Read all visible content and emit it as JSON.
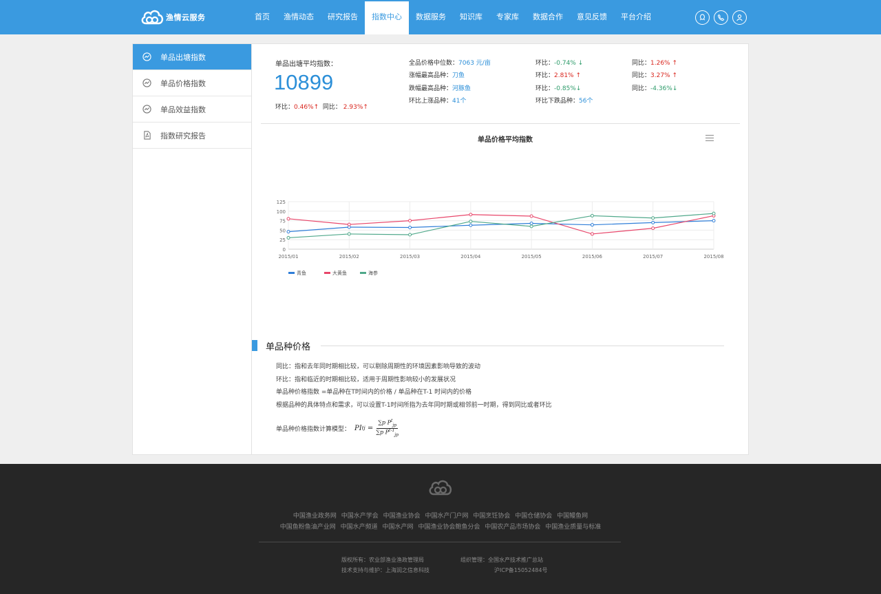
{
  "header": {
    "logo_text": "渔情云服务",
    "nav": [
      "首页",
      "渔情动态",
      "研究报告",
      "指数中心",
      "数据服务",
      "知识库",
      "专家库",
      "数据合作",
      "意见反馈",
      "平台介绍"
    ],
    "active_nav": "指数中心",
    "icons": [
      "qq-icon",
      "phone-icon",
      "user-icon"
    ]
  },
  "sidebar": {
    "items": [
      {
        "label": "单品出塘指数",
        "icon": "trend-icon",
        "active": true
      },
      {
        "label": "单品价格指数",
        "icon": "trend-icon",
        "active": false
      },
      {
        "label": "单品效益指数",
        "icon": "trend-icon",
        "active": false
      },
      {
        "label": "指数研究报告",
        "icon": "pdf-icon",
        "active": false
      }
    ]
  },
  "stats": {
    "avg_label": "单品出塘平均指数：",
    "avg_value": "10899",
    "huanbi_label": "环比：",
    "huanbi_value": "0.46%",
    "tongbi_label": "同比：",
    "tongbi_value": "2.93%",
    "rows": [
      {
        "label": "全品价格中位数：",
        "value": "7063 元/亩",
        "hb_label": "环比：",
        "hb": "-0.74%",
        "hb_dir": "down",
        "tb_label": "同比：",
        "tb": "1.26%",
        "tb_dir": "up"
      },
      {
        "label": "涨幅最高品种：",
        "value": "刀鱼",
        "hb_label": "环比：",
        "hb": "2.81%",
        "hb_dir": "up",
        "tb_label": "同比：",
        "tb": "3.27%",
        "tb_dir": "up"
      },
      {
        "label": "跌幅最高品种：",
        "value": "河豚鱼",
        "hb_label": "环比：",
        "hb": "-0.85%",
        "hb_dir": "down",
        "tb_label": "同比：",
        "tb": "-4.36%",
        "tb_dir": "down"
      }
    ],
    "up_label": "环比上涨品种：",
    "up_value": "41个",
    "down_label": "环比下跌品种：",
    "down_value": "56个"
  },
  "chart_data": {
    "type": "line",
    "title": "单品价格平均指数",
    "x": [
      "2015/01",
      "2015/02",
      "2015/03",
      "2015/04",
      "2015/05",
      "2015/06",
      "2015/07",
      "2015/08"
    ],
    "ylim": [
      0,
      125
    ],
    "yticks": [
      0,
      25,
      50,
      75,
      100,
      125
    ],
    "grid": true,
    "legend": "bottom-left",
    "series": [
      {
        "name": "青鱼",
        "color": "#2f7ed8",
        "values": [
          46,
          58,
          57,
          63,
          68,
          64,
          70,
          75
        ]
      },
      {
        "name": "大黄鱼",
        "color": "#e8466a",
        "values": [
          80,
          65,
          75,
          91,
          87,
          40,
          55,
          88
        ]
      },
      {
        "name": "海参",
        "color": "#4fa88a",
        "values": [
          30,
          40,
          38,
          73,
          60,
          88,
          82,
          94
        ]
      }
    ]
  },
  "section": {
    "title": "单品种价格",
    "lines": [
      "同比：指和去年同时期相比较，可以剔除周期性的环境因素影响导致的波动",
      "环比：指和临近的时期相比较，适用于周期性影响较小的发展状况",
      "单品种价格指数 =单品种在T时间内的价格 / 单品种在T-1 时间内的价格",
      "根据品种的具体特点和需求，可以设置T-1时间所指为去年同时期或相邻前一时期，得到同比或者环比"
    ],
    "formula_label": "单品种价格指数计算模型：",
    "formula_lhs": "PI",
    "formula_num": "∑p P",
    "formula_den": "∑p P"
  },
  "footer": {
    "links_row1": [
      "中国渔业政务网",
      "中国水产学会",
      "中国渔业协会",
      "中国水产门户网",
      "中国烹饪协会",
      "中国仓储协会",
      "中国鳗鱼网"
    ],
    "links_row2": [
      "中国鱼粉鱼油产业网",
      "中国水产频道",
      "中国水产网",
      "中国渔业协会鲍鱼分会",
      "中国农产品市场协会",
      "中国渔业质量与标准"
    ],
    "copyright": "版权所有：农业部渔业渔政管理局",
    "organizer": "组织管理：全国水产技术推广总站",
    "tech": "技术支持与维护：上海润之信息科技",
    "icp": "沪ICP备15052484号"
  }
}
